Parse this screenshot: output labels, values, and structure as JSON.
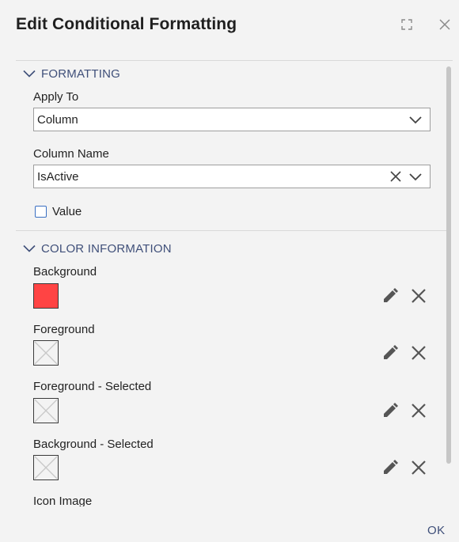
{
  "dialog": {
    "title": "Edit Conditional Formatting",
    "maximize_icon": "maximize-icon",
    "close_icon": "close-icon",
    "ok_label": "OK"
  },
  "formatting": {
    "section_label": "FORMATTING",
    "apply_to": {
      "label": "Apply To",
      "value": "Column"
    },
    "column_name": {
      "label": "Column Name",
      "value": "IsActive"
    },
    "value_checkbox": {
      "label": "Value",
      "checked": false
    }
  },
  "color_information": {
    "section_label": "COLOR INFORMATION",
    "rows": [
      {
        "label": "Background",
        "color": "#ff4444",
        "set": true
      },
      {
        "label": "Foreground",
        "color": null,
        "set": false
      },
      {
        "label": "Foreground - Selected",
        "color": null,
        "set": false
      },
      {
        "label": "Background - Selected",
        "color": null,
        "set": false
      }
    ],
    "icon_image_label": "Icon Image"
  },
  "colors": {
    "accent": "#3f4f79",
    "checkbox_border": "#3a6fc2"
  }
}
